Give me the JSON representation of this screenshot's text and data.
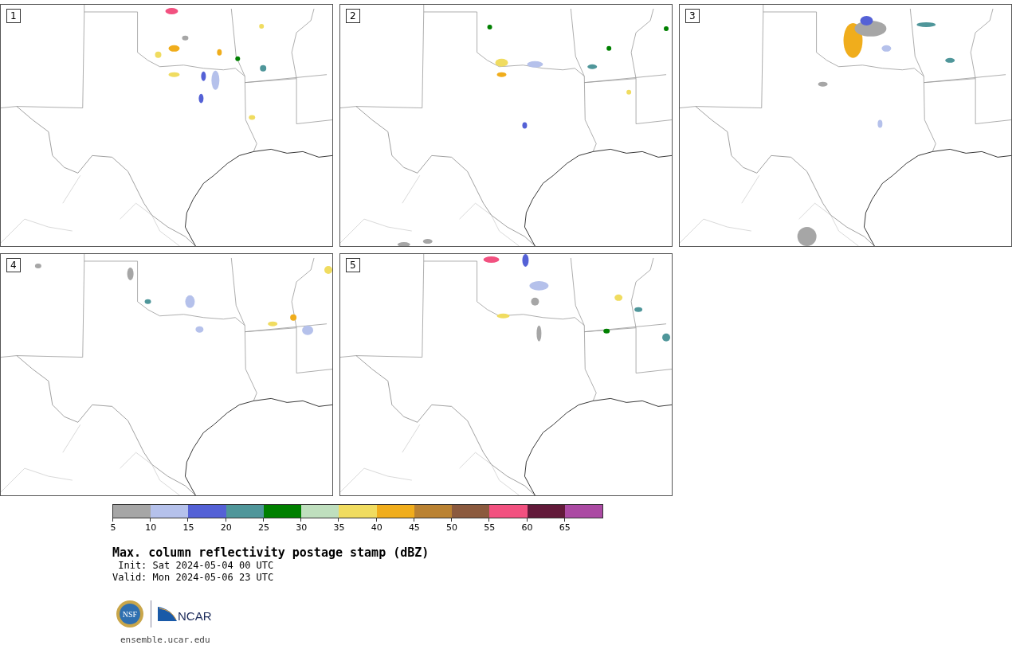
{
  "panels": [
    {
      "label": "1"
    },
    {
      "label": "2"
    },
    {
      "label": "3"
    },
    {
      "label": "4"
    },
    {
      "label": "5"
    }
  ],
  "colorbar": {
    "segments": [
      {
        "color": "#a6a6a6"
      },
      {
        "color": "#b5c1eb"
      },
      {
        "color": "#5461d6"
      },
      {
        "color": "#4f969a"
      },
      {
        "color": "#008000"
      },
      {
        "color": "#bfdfbe"
      },
      {
        "color": "#f0dc60"
      },
      {
        "color": "#f0ad1c"
      },
      {
        "color": "#ba8232"
      },
      {
        "color": "#8b5a3e"
      },
      {
        "color": "#f25180"
      },
      {
        "color": "#621a3a"
      },
      {
        "color": "#ab4aa3"
      }
    ],
    "ticks": [
      "5",
      "10",
      "15",
      "20",
      "25",
      "30",
      "35",
      "40",
      "45",
      "50",
      "55",
      "60",
      "65"
    ]
  },
  "title": "Max. column reflectivity postage stamp (dBZ)",
  "init": "Init: Sat 2024-05-04 00 UTC",
  "valid": "Valid: Mon 2024-05-06 23 UTC",
  "logos": {
    "nsf": "NSF",
    "ncar": "NCAR"
  },
  "url": "ensemble.ucar.edu"
}
